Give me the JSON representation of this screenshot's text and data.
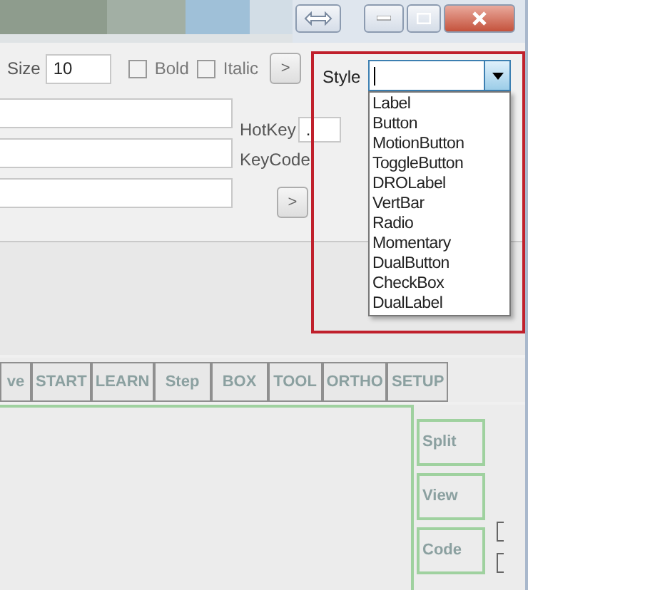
{
  "font_row": {
    "size_label": "Size",
    "size_value": "10",
    "options": [
      {
        "label": "Bold",
        "checked": false
      },
      {
        "label": "Italic",
        "checked": false
      }
    ],
    "more_button": ">"
  },
  "style": {
    "label": "Style",
    "expanded": true,
    "options": [
      "Label",
      "Button",
      "MotionButton",
      "ToggleButton",
      "DROLabel",
      "VertBar",
      "Radio",
      "Momentary",
      "DualButton",
      "CheckBox",
      "DualLabel"
    ]
  },
  "hotkey": {
    "label": "HotKey",
    "value": "."
  },
  "keycode": {
    "label": "KeyCode"
  },
  "text_row_button": ">",
  "toolbar_buttons": [
    "ve",
    "START",
    "LEARN",
    "Step",
    "BOX",
    "TOOL",
    "ORTHO",
    "SETUP"
  ],
  "side_buttons": [
    "Split",
    "View",
    "Code"
  ]
}
